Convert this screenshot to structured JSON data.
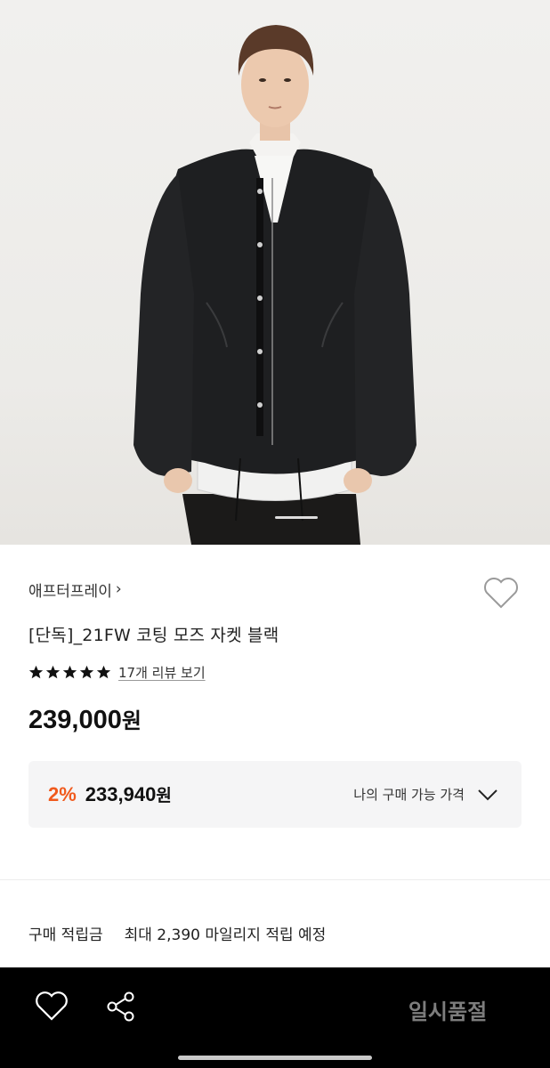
{
  "product": {
    "brand": "애프터프레이",
    "brand_chevron": "›",
    "title": "[단독]_21FW 코팅 모즈 자켓 블랙",
    "rating_stars": 5,
    "review_link": "17개 리뷰 보기",
    "price_number": "239,000",
    "price_unit": "원"
  },
  "member_price": {
    "discount": "2%",
    "amount": "233,940",
    "unit": "원",
    "label": "나의 구매 가능 가격"
  },
  "points": {
    "label": "구매 적립금",
    "value": "최대 2,390 마일리지 적립 예정"
  },
  "bottom_bar": {
    "button_label": "일시품절"
  },
  "icons": {
    "wishlist": "heart-outline-icon",
    "share": "share-icon",
    "dropdown": "chevron-down-icon",
    "star": "star-icon"
  },
  "colors": {
    "discount": "#f05a1d",
    "bottom_bar": "#000000",
    "soldout_text": "#7d7d7d"
  }
}
